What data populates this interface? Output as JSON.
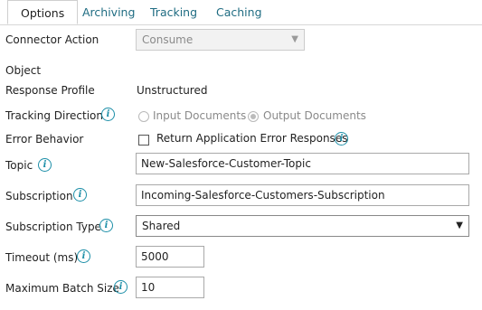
{
  "tabs": [
    {
      "label": "Options",
      "active": true
    },
    {
      "label": "Archiving",
      "active": false
    },
    {
      "label": "Tracking",
      "active": false
    },
    {
      "label": "Caching",
      "active": false
    }
  ],
  "fields": {
    "connector_action": {
      "label": "Connector Action",
      "value": "Consume"
    },
    "object": {
      "label": "Object"
    },
    "response_profile": {
      "label": "Response Profile",
      "value": "Unstructured"
    },
    "tracking_direction": {
      "label": "Tracking Direction",
      "options": [
        "Input Documents",
        "Output Documents"
      ],
      "selected": "Output Documents"
    },
    "error_behavior": {
      "label": "Error Behavior",
      "checkbox_label": "Return Application Error Responses",
      "checked": false
    },
    "topic": {
      "label": "Topic",
      "value": "New-Salesforce-Customer-Topic"
    },
    "subscription": {
      "label": "Subscription",
      "value": "Incoming-Salesforce-Customers-Subscription"
    },
    "subscription_type": {
      "label": "Subscription Type",
      "value": "Shared"
    },
    "timeout": {
      "label": "Timeout (ms)",
      "value": "5000"
    },
    "max_batch": {
      "label": "Maximum Batch Size",
      "value": "10"
    }
  },
  "icons": {
    "info": "i",
    "dropdown": "▼"
  },
  "colors": {
    "tab_link": "#1f6c82",
    "info_icon": "#1d8fa8"
  }
}
